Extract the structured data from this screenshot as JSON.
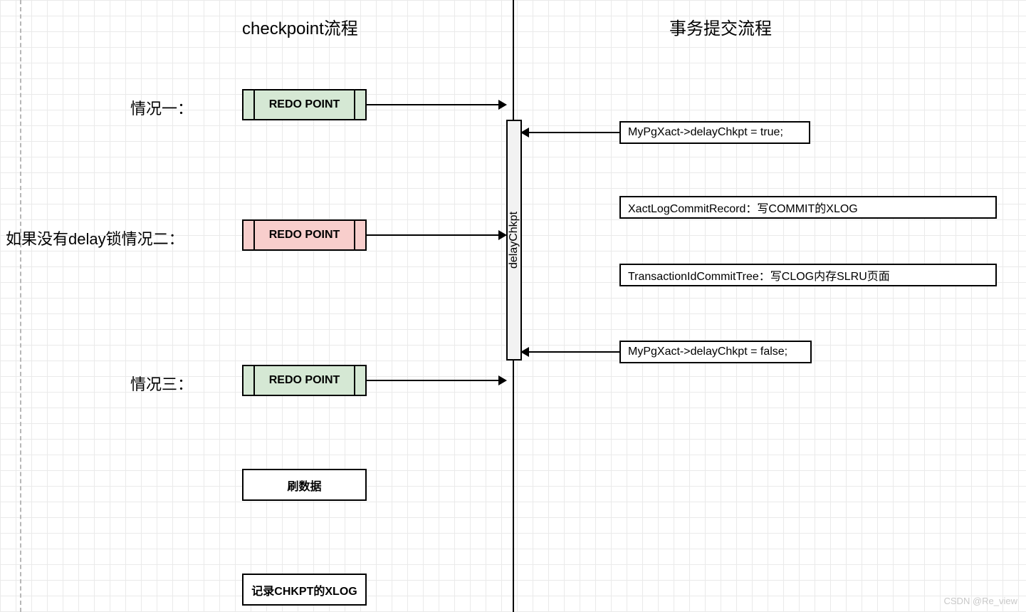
{
  "titles": {
    "left": "checkpoint流程",
    "right": "事务提交流程"
  },
  "cases": {
    "case1_label": "情况一：",
    "case2_label": "如果没有delay锁情况二：",
    "case3_label": "情况三："
  },
  "redo_point_text": "REDO POINT",
  "left_boxes": {
    "flush_data": "刷数据",
    "record_chkpt": "记录CHKPT的XLOG"
  },
  "delay_bar_text": "delayChkpt",
  "right_boxes": {
    "delay_true": "MyPgXact->delayChkpt = true;",
    "xact_log": "XactLogCommitRecord：写COMMIT的XLOG",
    "txn_id_commit": "TransactionIdCommitTree：写CLOG内存SLRU页面",
    "delay_false": "MyPgXact->delayChkpt = false;"
  },
  "watermark": "CSDN @Re_view"
}
